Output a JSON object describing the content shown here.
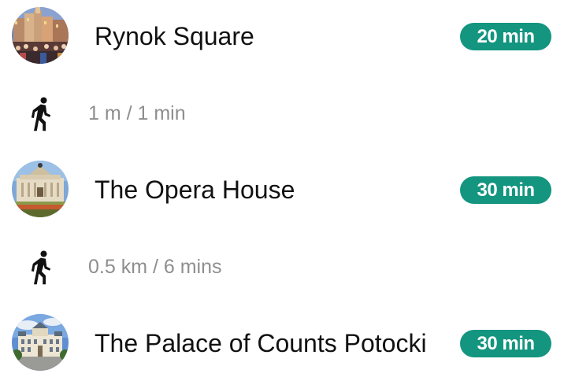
{
  "route": {
    "stops": [
      {
        "name": "Rynok Square",
        "duration": "20 min",
        "thumbnail_icon": "photo-rynok-square"
      },
      {
        "name": "The Opera House",
        "duration": "30 min",
        "thumbnail_icon": "photo-opera-house"
      },
      {
        "name": "The Palace of Counts Potocki",
        "duration": "30 min",
        "thumbnail_icon": "photo-potocki-palace"
      }
    ],
    "legs": [
      {
        "mode_icon": "walking-person-icon",
        "distance_time": "1 m / 1 min"
      },
      {
        "mode_icon": "walking-person-icon",
        "distance_time": "0.5 km / 6 mins"
      }
    ]
  },
  "colors": {
    "badge_background": "#13957f",
    "badge_text": "#ffffff",
    "stop_name": "#111111",
    "leg_text": "#8e8e8e"
  }
}
